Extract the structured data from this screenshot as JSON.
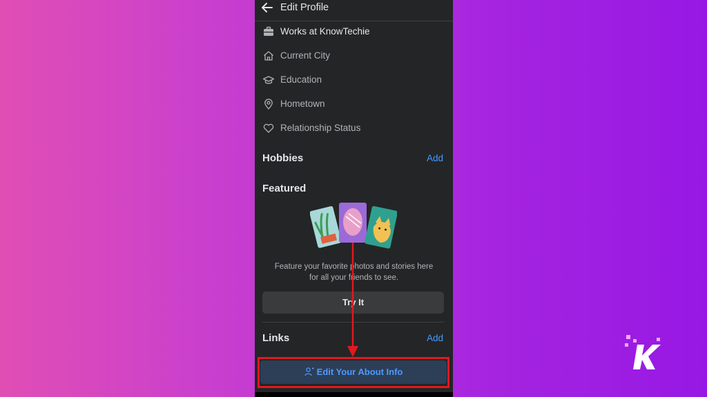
{
  "header": {
    "title": "Edit Profile"
  },
  "info_rows": [
    {
      "label": "Works at KnowTechie",
      "icon": "briefcase-icon",
      "style": "primary"
    },
    {
      "label": "Current City",
      "icon": "home-icon",
      "style": "muted"
    },
    {
      "label": "Education",
      "icon": "graduation-cap-icon",
      "style": "muted"
    },
    {
      "label": "Hometown",
      "icon": "location-pin-icon",
      "style": "muted"
    },
    {
      "label": "Relationship Status",
      "icon": "heart-icon",
      "style": "muted"
    }
  ],
  "hobbies": {
    "title": "Hobbies",
    "add_label": "Add"
  },
  "featured": {
    "title": "Featured",
    "description_line1": "Feature your favorite photos and stories here",
    "description_line2": "for all your friends to see.",
    "try_label": "Try It"
  },
  "links": {
    "title": "Links",
    "add_label": "Add"
  },
  "edit_about": {
    "label": "Edit Your About Info"
  },
  "colors": {
    "background": "#242526",
    "link_blue": "#4599ff",
    "annotation_red": "#e0191f",
    "gradient_left": "#e04eb4",
    "gradient_right": "#9718e4"
  }
}
